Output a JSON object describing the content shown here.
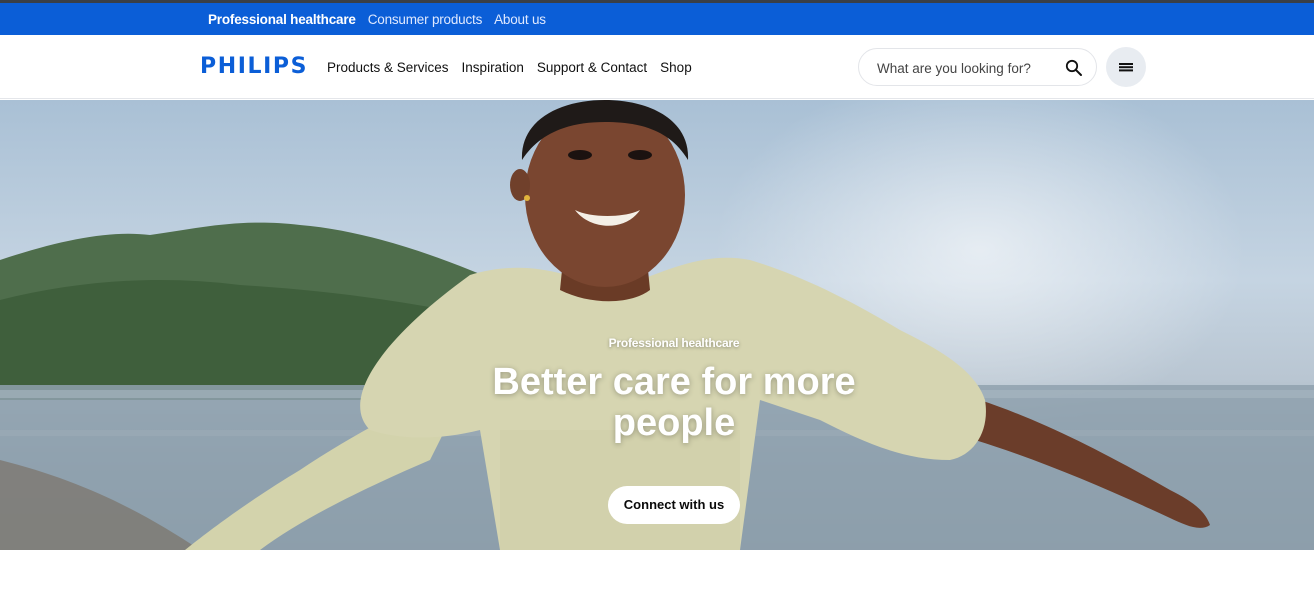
{
  "utility_nav": {
    "items": [
      {
        "label": "Professional healthcare",
        "active": true
      },
      {
        "label": "Consumer products",
        "active": false
      },
      {
        "label": "About us",
        "active": false
      }
    ]
  },
  "header": {
    "logo_text": "PHILIPS",
    "nav": [
      {
        "label": "Products & Services"
      },
      {
        "label": "Inspiration"
      },
      {
        "label": "Support & Contact"
      },
      {
        "label": "Shop"
      }
    ],
    "search": {
      "placeholder": "What are you looking for?",
      "icon": "search-icon"
    },
    "menu_icon": "hamburger-menu-icon"
  },
  "hero": {
    "eyebrow": "Professional healthcare",
    "title": "Better care for more people",
    "cta_label": "Connect with us"
  },
  "colors": {
    "brand_blue": "#0b5ed7",
    "utility_bar": "#0b5ed7",
    "white": "#ffffff"
  }
}
